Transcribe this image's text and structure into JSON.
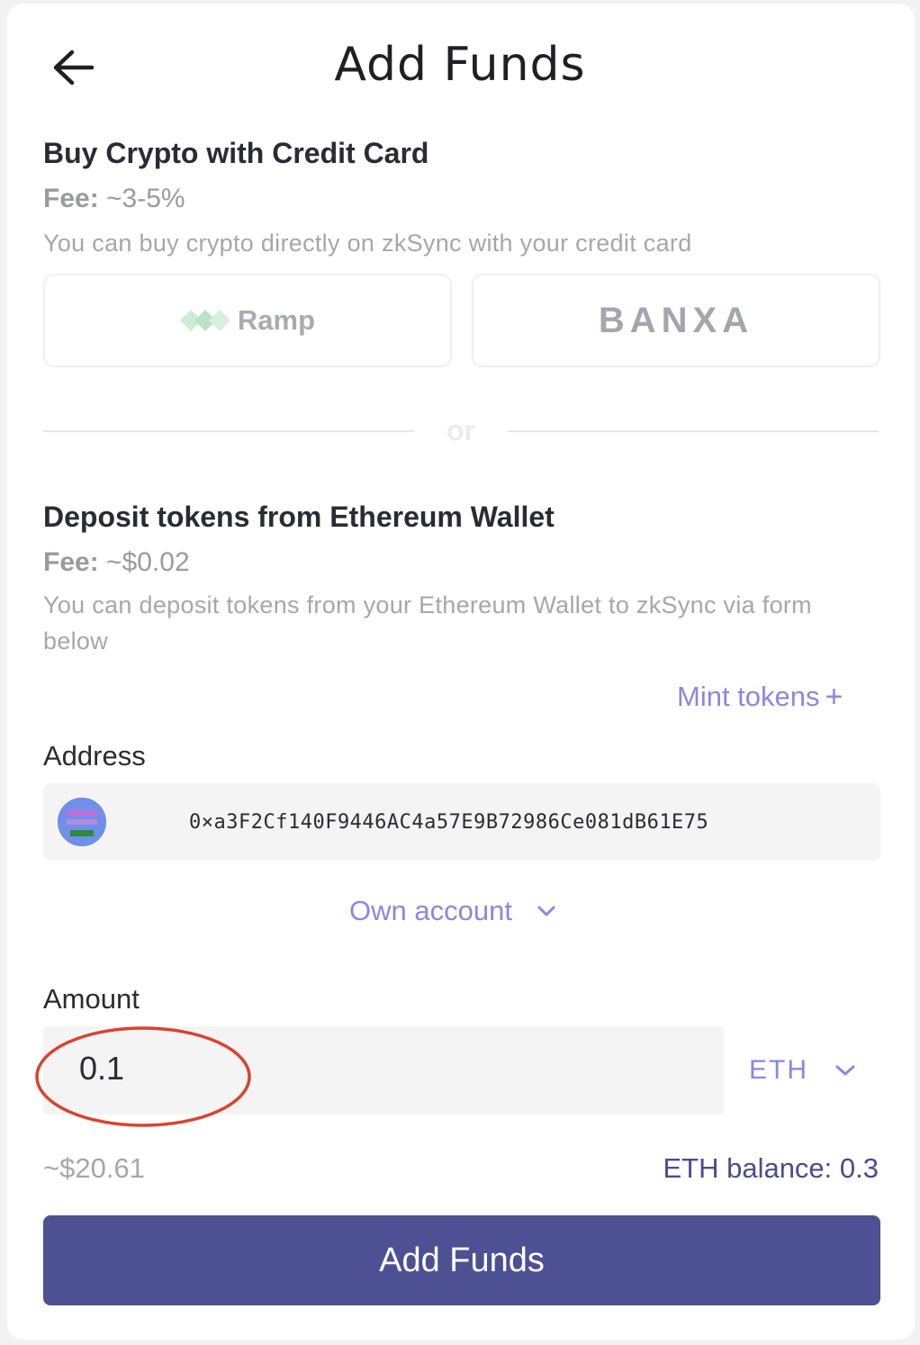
{
  "header": {
    "title": "Add Funds",
    "back_icon": "arrow-left-icon"
  },
  "credit_card": {
    "title": "Buy Crypto with Credit Card",
    "fee_label": "Fee:",
    "fee_value": "~3-5%",
    "description": "You can buy crypto directly on zkSync with your credit card",
    "providers": [
      {
        "name": "Ramp"
      },
      {
        "name": "BANXA"
      }
    ]
  },
  "divider_text": "or",
  "deposit": {
    "title": "Deposit tokens from Ethereum Wallet",
    "fee_label": "Fee:",
    "fee_value": "~$0.02",
    "description": "You can deposit tokens from your Ethereum Wallet to zkSync via form below",
    "mint_label": "Mint tokens",
    "mint_icon": "plus-icon"
  },
  "address": {
    "label": "Address",
    "value": "0×a3F2Cf140F9446AC4a57E9B72986Ce081dB61E75",
    "account_type": "Own account"
  },
  "amount": {
    "label": "Amount",
    "value": "0.1",
    "token": "ETH",
    "usd_value": "~$20.61",
    "balance_text": "ETH balance: 0.3"
  },
  "submit_label": "Add Funds",
  "colors": {
    "accent": "#8c87dd",
    "primary_button": "#4e5094",
    "balance": "#4a4c8f",
    "highlight": "#d9432f"
  }
}
